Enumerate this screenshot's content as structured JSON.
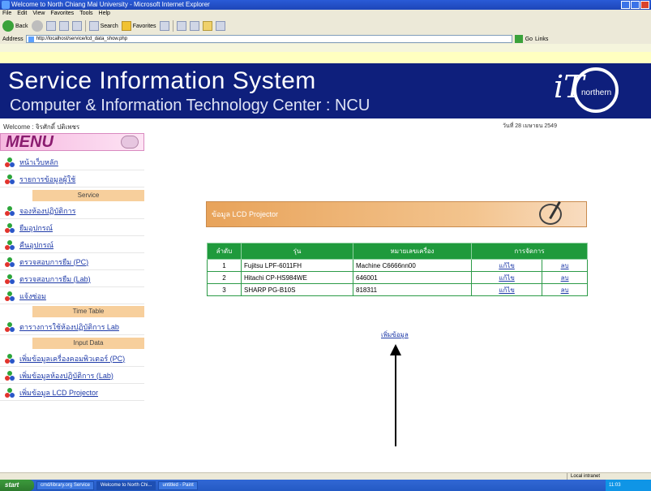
{
  "window": {
    "title": "Welcome to North Chiang Mai University - Microsoft Internet Explorer",
    "menu": [
      "File",
      "Edit",
      "View",
      "Favorites",
      "Tools",
      "Help"
    ]
  },
  "toolbar": {
    "back_label": "Back",
    "search_label": "Search",
    "favorites_label": "Favorites"
  },
  "address": {
    "label": "Address",
    "url": "http://localhost/service/lcd_data_show.php",
    "go_label": "Go",
    "links_label": "Links"
  },
  "banner": {
    "title": "Service Information System",
    "subtitle": "Computer & Information Technology Center : NCU",
    "logo_it": "iT",
    "logo_brand": "northern"
  },
  "header": {
    "welcome": "Welcome : จิรศักดิ์ ปติเพชร",
    "date": "วันที่ 28 เมษายน 2549"
  },
  "sidebar": {
    "menu_title": "MENU",
    "items": [
      {
        "label": "หน้าเว็บหลัก"
      },
      {
        "label": "รายการข้อมูลผู้ใช้"
      }
    ],
    "section_service": "Service",
    "service_items": [
      {
        "label": "จองห้องปฏิบัติการ"
      },
      {
        "label": "ยืมอุปกรณ์"
      },
      {
        "label": "คืนอุปกรณ์"
      },
      {
        "label": "ตรวจสอบการยืม (PC)"
      },
      {
        "label": "ตรวจสอบการยืม (Lab)"
      },
      {
        "label": "แจ้งซ่อม"
      }
    ],
    "section_timetable": "Time Table",
    "timetable_items": [
      {
        "label": "ตารางการใช้ห้องปฏิบัติการ Lab"
      }
    ],
    "section_input": "Input Data",
    "input_items": [
      {
        "label": "เพิ่มข้อมูลเครื่องคอมพิวเตอร์ (PC)"
      },
      {
        "label": "เพิ่มข้อมูลห้องปฏิบัติการ (Lab)"
      },
      {
        "label": "เพิ่มข้อมูล LCD Projector"
      }
    ]
  },
  "main": {
    "panel_title": "ข้อมูล LCD Projector",
    "table": {
      "headers": [
        "ลำดับ",
        "รุ่น",
        "หมายเลขเครื่อง",
        "การจัดการ"
      ],
      "rows": [
        {
          "no": "1",
          "model": "Fujitsu LPF-6011FH",
          "serial": "Machine C6666nn00",
          "edit": "แก้ไข",
          "delete": "ลบ"
        },
        {
          "no": "2",
          "model": "Hitachi CP-HS984WE",
          "serial": "646001",
          "edit": "แก้ไข",
          "delete": "ลบ"
        },
        {
          "no": "3",
          "model": "SHARP PG-B10S",
          "serial": "818311",
          "edit": "แก้ไข",
          "delete": "ลบ"
        }
      ]
    },
    "add_link": "เพิ่มข้อมูล"
  },
  "statusbar": {
    "zone": "Local intranet"
  },
  "taskbar": {
    "start": "start",
    "tasks": [
      "cmd/library.org Service",
      "Welcome to North Chi...",
      "untitled - Paint"
    ],
    "clock": "11:03"
  }
}
